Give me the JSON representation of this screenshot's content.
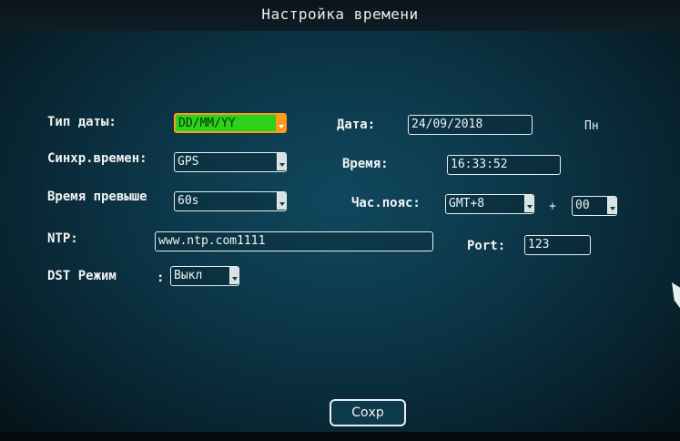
{
  "window": {
    "title": "Настройка времени"
  },
  "fields": {
    "date_type": {
      "label": "Тип даты:",
      "value": "DD/MM/YY"
    },
    "date": {
      "label": "Дата:",
      "value": "24/09/2018",
      "weekday": "Пн"
    },
    "sync": {
      "label": "Синхр.времен:",
      "value": "GPS"
    },
    "time": {
      "label": "Время:",
      "value": "16:33:52"
    },
    "timeout": {
      "label": "Время превыше",
      "value": "60s"
    },
    "timezone": {
      "label": "Час.пояс:",
      "value": "GMT+8",
      "sign": "+",
      "offset": "00"
    },
    "ntp": {
      "label": "NTP:",
      "value": "www.ntp.com1111"
    },
    "port": {
      "label": "Port:",
      "value": "123"
    },
    "dst": {
      "label": "DST Режим",
      "colon": ":",
      "value": "Выкл"
    }
  },
  "actions": {
    "save_label": "Сохр"
  },
  "colors": {
    "selected_bg": "#2bd11b",
    "selected_border": "#ff9a1a",
    "panel": "#0c3648"
  }
}
